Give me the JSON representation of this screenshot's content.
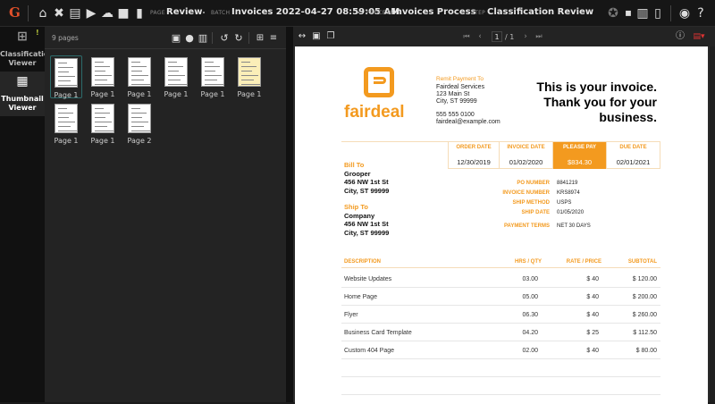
{
  "topbar": {
    "logo": "G",
    "page_label": "PAGE",
    "page": "Review",
    "batch_label": "BATCH",
    "batch": "Invoices 2022-04-27 08:59:05 AM",
    "process_label": "PROCESS",
    "process": "Invoices Process",
    "step_label": "STEP",
    "step": "Classification Review"
  },
  "rail": {
    "classification": "Classification Viewer",
    "thumbnail": "Thumbnail Viewer",
    "badge": "!"
  },
  "thumbs": {
    "count": "9 pages",
    "items": [
      "Page 1",
      "Page 1",
      "Page 1",
      "Page 1",
      "Page 1",
      "Page 1",
      "Page 1",
      "Page 1",
      "Page 2"
    ]
  },
  "viewer": {
    "page_current": "1",
    "page_total": "/ 1"
  },
  "invoice": {
    "brand": "fairdeal",
    "accent": "#f39a1f",
    "remit_label": "Remit Payment To",
    "remit": [
      "Fairdeal Services",
      "123 Main St",
      "City, ST 99999"
    ],
    "phone": "555 555 0100",
    "email": "fairdeal@example.com",
    "headline": [
      "This is your invoice.",
      "Thank you for your",
      "business."
    ],
    "dates": [
      {
        "h": "ORDER DATE",
        "v": "12/30/2019"
      },
      {
        "h": "INVOICE DATE",
        "v": "01/02/2020"
      },
      {
        "h": "PLEASE PAY",
        "v": "$834.30"
      },
      {
        "h": "DUE DATE",
        "v": "02/01/2021"
      }
    ],
    "bill_label": "Bill To",
    "bill": [
      "Grooper",
      "456 NW 1st St",
      "City, ST 99999"
    ],
    "ship_label": "Ship To",
    "ship": [
      "Company",
      "456 NW 1st St",
      "City, ST 99999"
    ],
    "fields": [
      {
        "k": "PO NUMBER",
        "v": "8841219"
      },
      {
        "k": "INVOICE NUMBER",
        "v": "KRS8974"
      },
      {
        "k": "SHIP METHOD",
        "v": "USPS"
      },
      {
        "k": "SHIP DATE",
        "v": "01/05/2020"
      },
      {
        "k": "PAYMENT TERMS",
        "v": "NET 30 DAYS"
      }
    ],
    "columns": [
      "DESCRIPTION",
      "HRS / QTY",
      "RATE / PRICE",
      "SUBTOTAL"
    ],
    "items": [
      [
        "Website Updates",
        "03.00",
        "$ 40",
        "$ 120.00"
      ],
      [
        "Home Page",
        "05.00",
        "$ 40",
        "$ 200.00"
      ],
      [
        "Flyer",
        "06.30",
        "$ 40",
        "$ 260.00"
      ],
      [
        "Business Card Template",
        "04.20",
        "$ 25",
        "$ 112.50"
      ],
      [
        "Custom 404 Page",
        "02.00",
        "$ 40",
        "$ 80.00"
      ]
    ]
  }
}
